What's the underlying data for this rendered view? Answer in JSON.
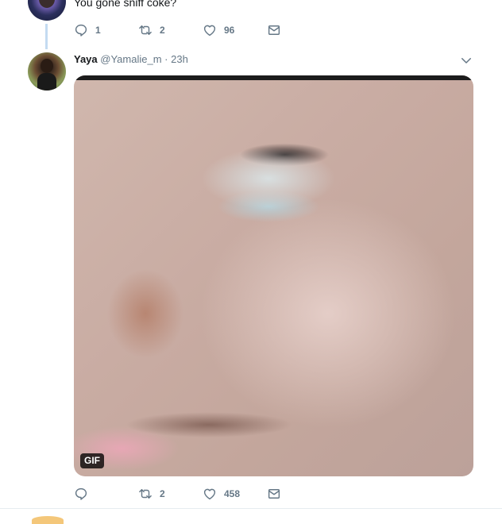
{
  "tweet_top": {
    "text": "You gone sniff coke?",
    "reply_count": "1",
    "retweet_count": "2",
    "like_count": "96"
  },
  "tweet_yaya": {
    "display_name": "Yaya",
    "handle": "@Yamalie_m",
    "separator": "·",
    "time": "23h",
    "media_badge": "GIF",
    "reply_count": "",
    "retweet_count": "2",
    "like_count": "458"
  },
  "icons": {
    "reply": "reply-icon",
    "retweet": "retweet-icon",
    "like": "heart-icon",
    "dm": "envelope-icon",
    "more": "chevron-down-icon"
  },
  "colors": {
    "icon_gray": "#657786",
    "thread_line": "#c4dbf1",
    "text": "#14171a"
  }
}
